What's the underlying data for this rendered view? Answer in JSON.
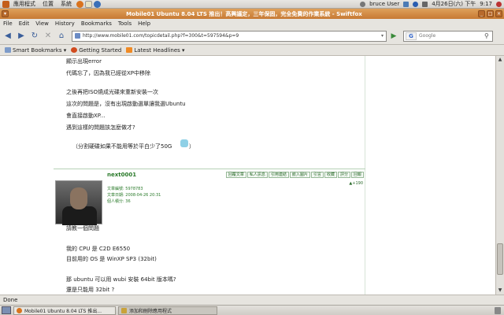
{
  "gnome_panel": {
    "menus": [
      "應用程式",
      "位置",
      "系統"
    ],
    "user": "bruce User",
    "date": "4月26日(六) 下午",
    "time": "9:17"
  },
  "window": {
    "title": "Mobile01 Ubuntu 8.04 LTS 推出！高興議定，三年保固，完全免費的作業系統 - Swiftfox"
  },
  "menubar": [
    "File",
    "Edit",
    "View",
    "History",
    "Bookmarks",
    "Tools",
    "Help"
  ],
  "navbar": {
    "url": "http://www.mobile01.com/topicdetail.php?f=300&t=597594&p=9",
    "search_placeholder": "Google"
  },
  "bookmarks": [
    "Smart Bookmarks ▾",
    "Getting Started",
    "Latest Headlines ▾"
  ],
  "post1_lines": [
    "顯示出現error",
    "代碼忘了，因為我已經從XP中移除",
    "",
    "之後再把ISO燒成光碟來重新安裝一次",
    "這次的問題是，沒有出現啟動選單讓我選Ubuntu",
    "會直接啟動XP...",
    "遇到這樣的問題該怎麼做才?",
    "",
    "（分割硬碟如果不能用等於平白少了50G",
    "）"
  ],
  "post2": {
    "username": "next0001",
    "meta": [
      "文章編號: 5978783",
      "文章日期: 2008-04-26 20:31",
      "個人積分: 36"
    ],
    "actions": [
      "回覆文章",
      "私人訊息",
      "引用連結",
      "嵌入圖片",
      "引言",
      "收藏",
      "評分",
      "回報"
    ],
    "rating": "▲+190",
    "lines": [
      "請教一個問題",
      "",
      "我的 CPU 是 C2D E6550",
      "目前用的 OS 是 WinXP SP3 (32bit)",
      "",
      "那 ubuntu 可以用 wubi 安裝 64bit 版本嗎?",
      "還是只能用 32bit ?"
    ]
  },
  "status": "Done",
  "taskbar": {
    "tasks": [
      "Mobile01 Ubuntu 8.04 LTS 推出...",
      "添加和刪除應用程式"
    ]
  },
  "colors": {
    "titlebar": "#c77a34",
    "username": "#2a7a2a",
    "link": "#3a5e9a"
  }
}
